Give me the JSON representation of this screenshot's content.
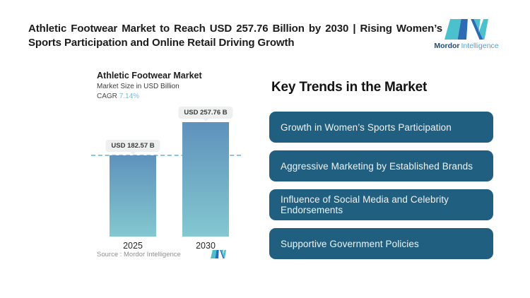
{
  "header": {
    "title_line1": "Athletic Footwear Market to Reach USD 257.76 Billion by 2030 | Rising Women’s",
    "title_line2": "Sports Participation and Online Retail Driving Growth"
  },
  "brand": {
    "name_bold": "Mordor",
    "name_light": "Intelligence",
    "colors": {
      "teal": "#4bc1ce",
      "blue": "#2b6cb4",
      "name_bold": "#1a4a7d",
      "name_light": "#4f9fd4"
    }
  },
  "chart": {
    "title": "Athletic Footwear Market",
    "subtitle": "Market Size in USD Billion",
    "cagr_label": "CAGR",
    "cagr_value": "7.14%",
    "source": "Source :  Mordor Intelligence"
  },
  "chart_data": {
    "type": "bar",
    "title": "Athletic Footwear Market",
    "ylabel": "Market Size in USD Billion",
    "cagr": "7.14%",
    "categories": [
      "2025",
      "2030"
    ],
    "values": [
      182.57,
      257.76
    ],
    "value_labels": [
      "USD 182.57 B",
      "USD 257.76 B"
    ],
    "unit": "USD Billion",
    "ylim": [
      0,
      270
    ],
    "grid": false,
    "reference_line": {
      "at_value": 182.57,
      "style": "dashed",
      "color": "#8cc3dd"
    },
    "bar_gradient_top": "#5e92bc",
    "bar_gradient_bottom": "#84c8d0"
  },
  "trends": {
    "heading": "Key Trends in the Market",
    "box_color": "#215f80",
    "items": [
      "Growth in Women’s Sports Participation",
      "Aggressive Marketing by Established Brands",
      "Influence of Social Media and Celebrity Endorsements",
      "Supportive Government Policies"
    ]
  }
}
